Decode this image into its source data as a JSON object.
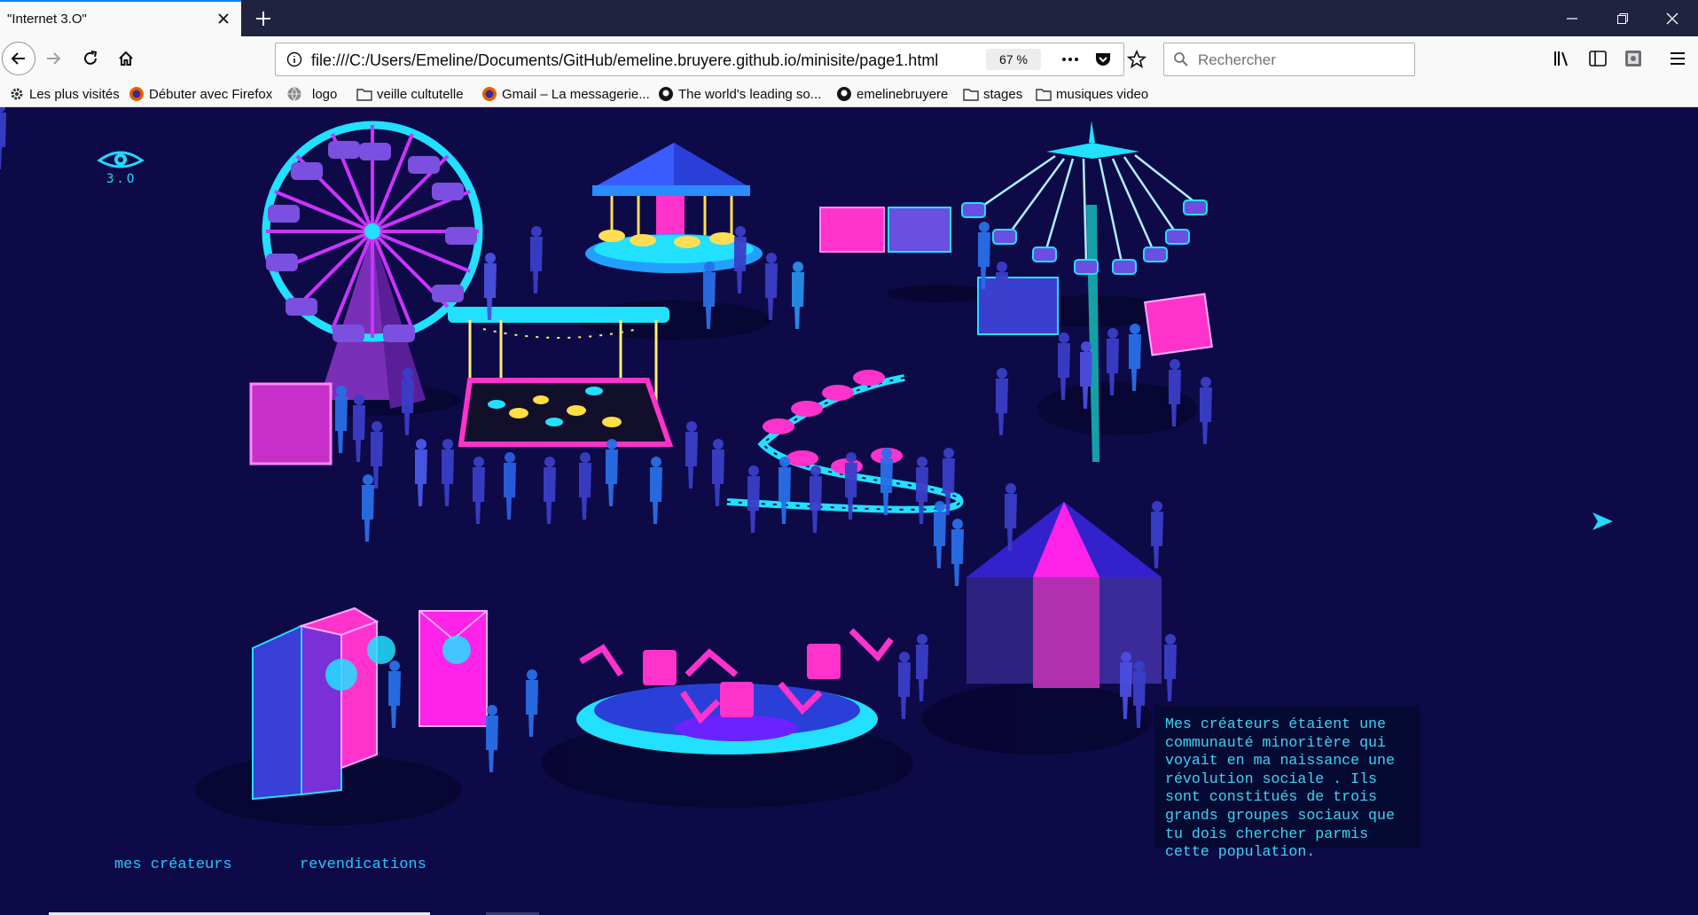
{
  "browser": {
    "tab_title": "\"Internet 3.O\"",
    "url": "file:///C:/Users/Emeline/Documents/GitHub/emeline.bruyere.github.io/minisite/page1.html",
    "zoom": "67 %",
    "search_placeholder": "Rechercher"
  },
  "bookmarks": [
    {
      "label": "Les plus visités",
      "icon": "gear-icon"
    },
    {
      "label": "Débuter avec Firefox",
      "icon": "firefox-icon"
    },
    {
      "label": "logo",
      "icon": "globe-icon"
    },
    {
      "label": "veille cultutelle",
      "icon": "folder-icon"
    },
    {
      "label": "Gmail – La messagerie...",
      "icon": "firefox-icon"
    },
    {
      "label": "The world's leading so...",
      "icon": "github-icon"
    },
    {
      "label": "emelinebruyere",
      "icon": "github-icon"
    },
    {
      "label": "stages",
      "icon": "folder-icon"
    },
    {
      "label": "musiques video",
      "icon": "folder-icon"
    }
  ],
  "page": {
    "logo_label": "3.O",
    "nav": {
      "creators": "mes créateurs",
      "claims": "revendications"
    },
    "story_text": "Mes créateurs étaient une communauté minoritère qui voyait en ma naissance une révolution sociale . Ils sont constitués de trois grands groupes sociaux que tu dois chercher parmis cette population."
  },
  "colors": {
    "background": "#0e0a48",
    "cyan": "#22e0ff",
    "magenta": "#ff22e8",
    "purple": "#5a3fd0"
  }
}
